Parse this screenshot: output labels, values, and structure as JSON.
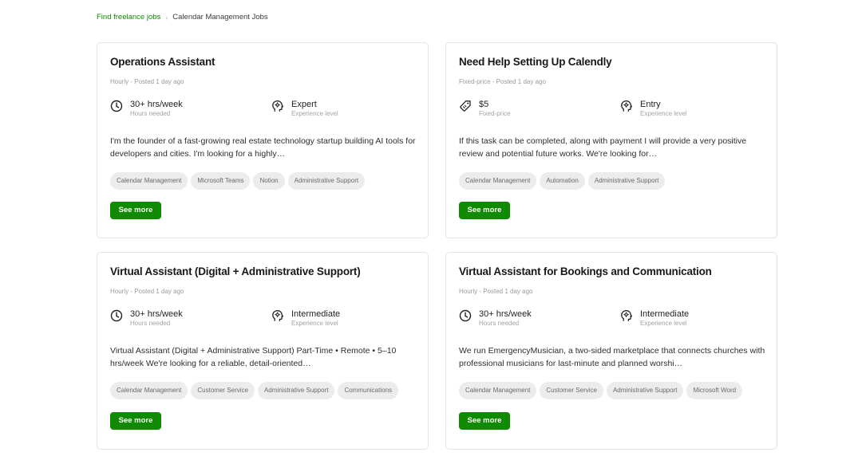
{
  "breadcrumb": {
    "link": "Find freelance jobs",
    "separator": "›",
    "current": "Calendar Management Jobs"
  },
  "colors": {
    "accent": "#108a00",
    "tag_bg": "#ececec"
  },
  "jobs": [
    {
      "title": "Operations Assistant",
      "meta": "Hourly - Posted 1 day ago",
      "stat1": {
        "icon": "clock-icon",
        "value": "30+ hrs/week",
        "label": "Hours needed"
      },
      "stat2": {
        "icon": "experience-icon",
        "value": "Expert",
        "label": "Experience level"
      },
      "description": "I'm the founder of a fast-growing real estate technology startup building AI tools for developers and cities. I'm looking for a highly…",
      "tags": [
        "Calendar Management",
        "Microsoft Teams",
        "Notion",
        "Administrative Support"
      ],
      "button": "See more"
    },
    {
      "title": "Need Help Setting Up Calendly",
      "meta": "Fixed-price - Posted 1 day ago",
      "stat1": {
        "icon": "price-tag-icon",
        "value": "$5",
        "label": "Fixed-price"
      },
      "stat2": {
        "icon": "experience-icon",
        "value": "Entry",
        "label": "Experience level"
      },
      "description": "If this task can be completed, along with payment I will provide a very positive review and potential future works. We're looking for…",
      "tags": [
        "Calendar Management",
        "Automation",
        "Administrative Support"
      ],
      "button": "See more"
    },
    {
      "title": "Virtual Assistant (Digital + Administrative Support)",
      "meta": "Hourly - Posted 1 day ago",
      "stat1": {
        "icon": "clock-icon",
        "value": "30+ hrs/week",
        "label": "Hours needed"
      },
      "stat2": {
        "icon": "experience-icon",
        "value": "Intermediate",
        "label": "Experience level"
      },
      "description": "Virtual Assistant (Digital + Administrative Support) Part-Time • Remote • 5–10 hrs/week We're looking for a reliable, detail-oriented…",
      "tags": [
        "Calendar Management",
        "Customer Service",
        "Administrative Support",
        "Communications"
      ],
      "button": "See more"
    },
    {
      "title": "Virtual Assistant for Bookings and Communication",
      "meta": "Hourly - Posted 1 day ago",
      "stat1": {
        "icon": "clock-icon",
        "value": "30+ hrs/week",
        "label": "Hours needed"
      },
      "stat2": {
        "icon": "experience-icon",
        "value": "Intermediate",
        "label": "Experience level"
      },
      "description": "We run EmergencyMusician, a two-sided marketplace that connects churches with professional musicians for last-minute and planned worshi…",
      "tags": [
        "Calendar Management",
        "Customer Service",
        "Administrative Support",
        "Microsoft Word"
      ],
      "button": "See more"
    }
  ]
}
